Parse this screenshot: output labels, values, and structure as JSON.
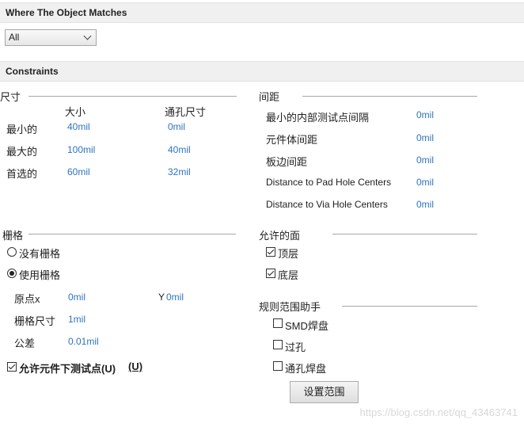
{
  "sections": {
    "where_title": "Where The Object Matches",
    "constraints_title": "Constraints"
  },
  "match_select": {
    "value": "All"
  },
  "size_group": {
    "title": "尺寸",
    "col_size": "大小",
    "col_via": "通孔尺寸",
    "rows": [
      {
        "label": "最小的",
        "size": "40mil",
        "via": "0mil"
      },
      {
        "label": "最大的",
        "size": "100mil",
        "via": "40mil"
      },
      {
        "label": "首选的",
        "size": "60mil",
        "via": "32mil"
      }
    ]
  },
  "clearance_group": {
    "title": "间距",
    "rows": [
      {
        "label": "最小的内部测试点间隔",
        "value": "0mil"
      },
      {
        "label": "元件体间距",
        "value": "0mil"
      },
      {
        "label": "板边间距",
        "value": "0mil"
      },
      {
        "label": "Distance to Pad Hole Centers",
        "value": "0mil"
      },
      {
        "label": "Distance to Via Hole Centers",
        "value": "0mil"
      }
    ]
  },
  "grid_group": {
    "title": "栅格",
    "no_grid": "没有栅格",
    "use_grid": "使用栅格",
    "selected": "use_grid",
    "origin_x_label": "原点x",
    "origin_x_value": "0mil",
    "origin_y_label": "Y",
    "origin_y_value": "0mil",
    "grid_size_label": "栅格尺寸",
    "grid_size_value": "1mil",
    "tolerance_label": "公差",
    "tolerance_value": "0.01mil",
    "allow_under": {
      "label": "允许元件下测试点(U)",
      "shortcut": "(U)",
      "checked": true
    }
  },
  "sides_group": {
    "title": "允许的面",
    "top": {
      "label": "顶层",
      "checked": true
    },
    "bottom": {
      "label": "底层",
      "checked": true
    }
  },
  "scope_group": {
    "title": "规则范围助手",
    "smd": {
      "label": "SMD焊盘",
      "checked": false
    },
    "via": {
      "label": "过孔",
      "checked": false
    },
    "th_pad": {
      "label": "通孔焊盘",
      "checked": false
    },
    "set_scope_button": "设置范围"
  },
  "watermark": "https://blog.csdn.net/qq_43463741"
}
